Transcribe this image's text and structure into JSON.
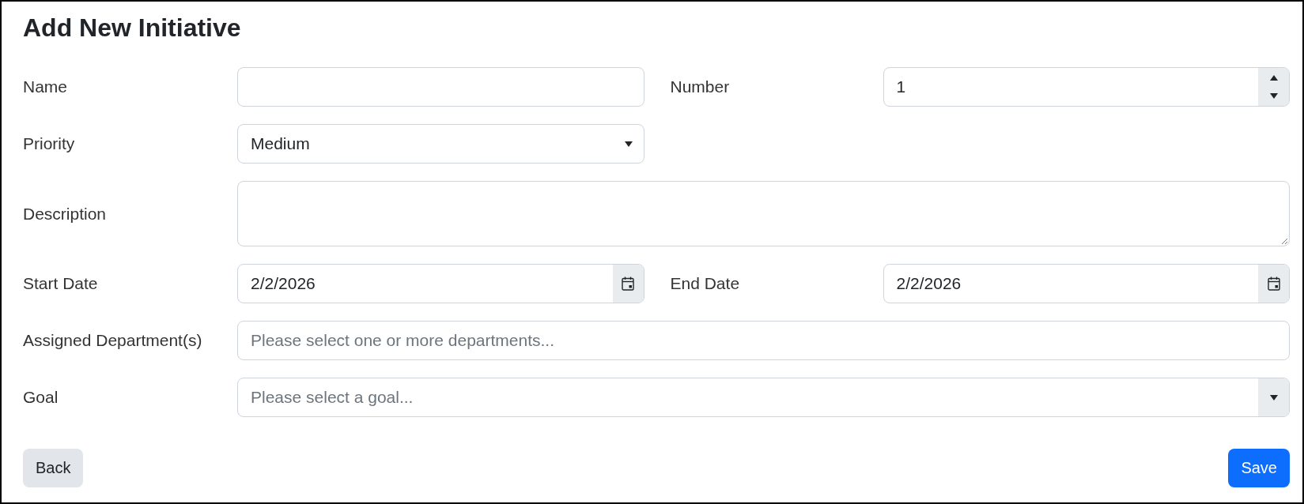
{
  "title": "Add New Initiative",
  "rows": [
    [
      {
        "kind": "text",
        "label": "Name"
      },
      {
        "kind": "number",
        "label": "Number",
        "value": "1"
      }
    ],
    [
      {
        "kind": "select",
        "label": "Priority",
        "value": "Medium"
      }
    ],
    [
      {
        "kind": "textarea",
        "label": "Description"
      }
    ],
    [
      {
        "kind": "date",
        "label": "Start Date",
        "value": "2/2/2026"
      },
      {
        "kind": "date",
        "label": "End Date",
        "value": "2/2/2026"
      }
    ],
    [
      {
        "kind": "multiselect",
        "label": "Assigned Department(s)",
        "placeholder": "Please select one or more departments..."
      }
    ],
    [
      {
        "kind": "combo",
        "label": "Goal",
        "placeholder": "Please select a goal..."
      }
    ]
  ],
  "buttons": [
    {
      "kind": "secondary",
      "label": "Back"
    },
    {
      "kind": "primary",
      "label": "Save"
    }
  ]
}
